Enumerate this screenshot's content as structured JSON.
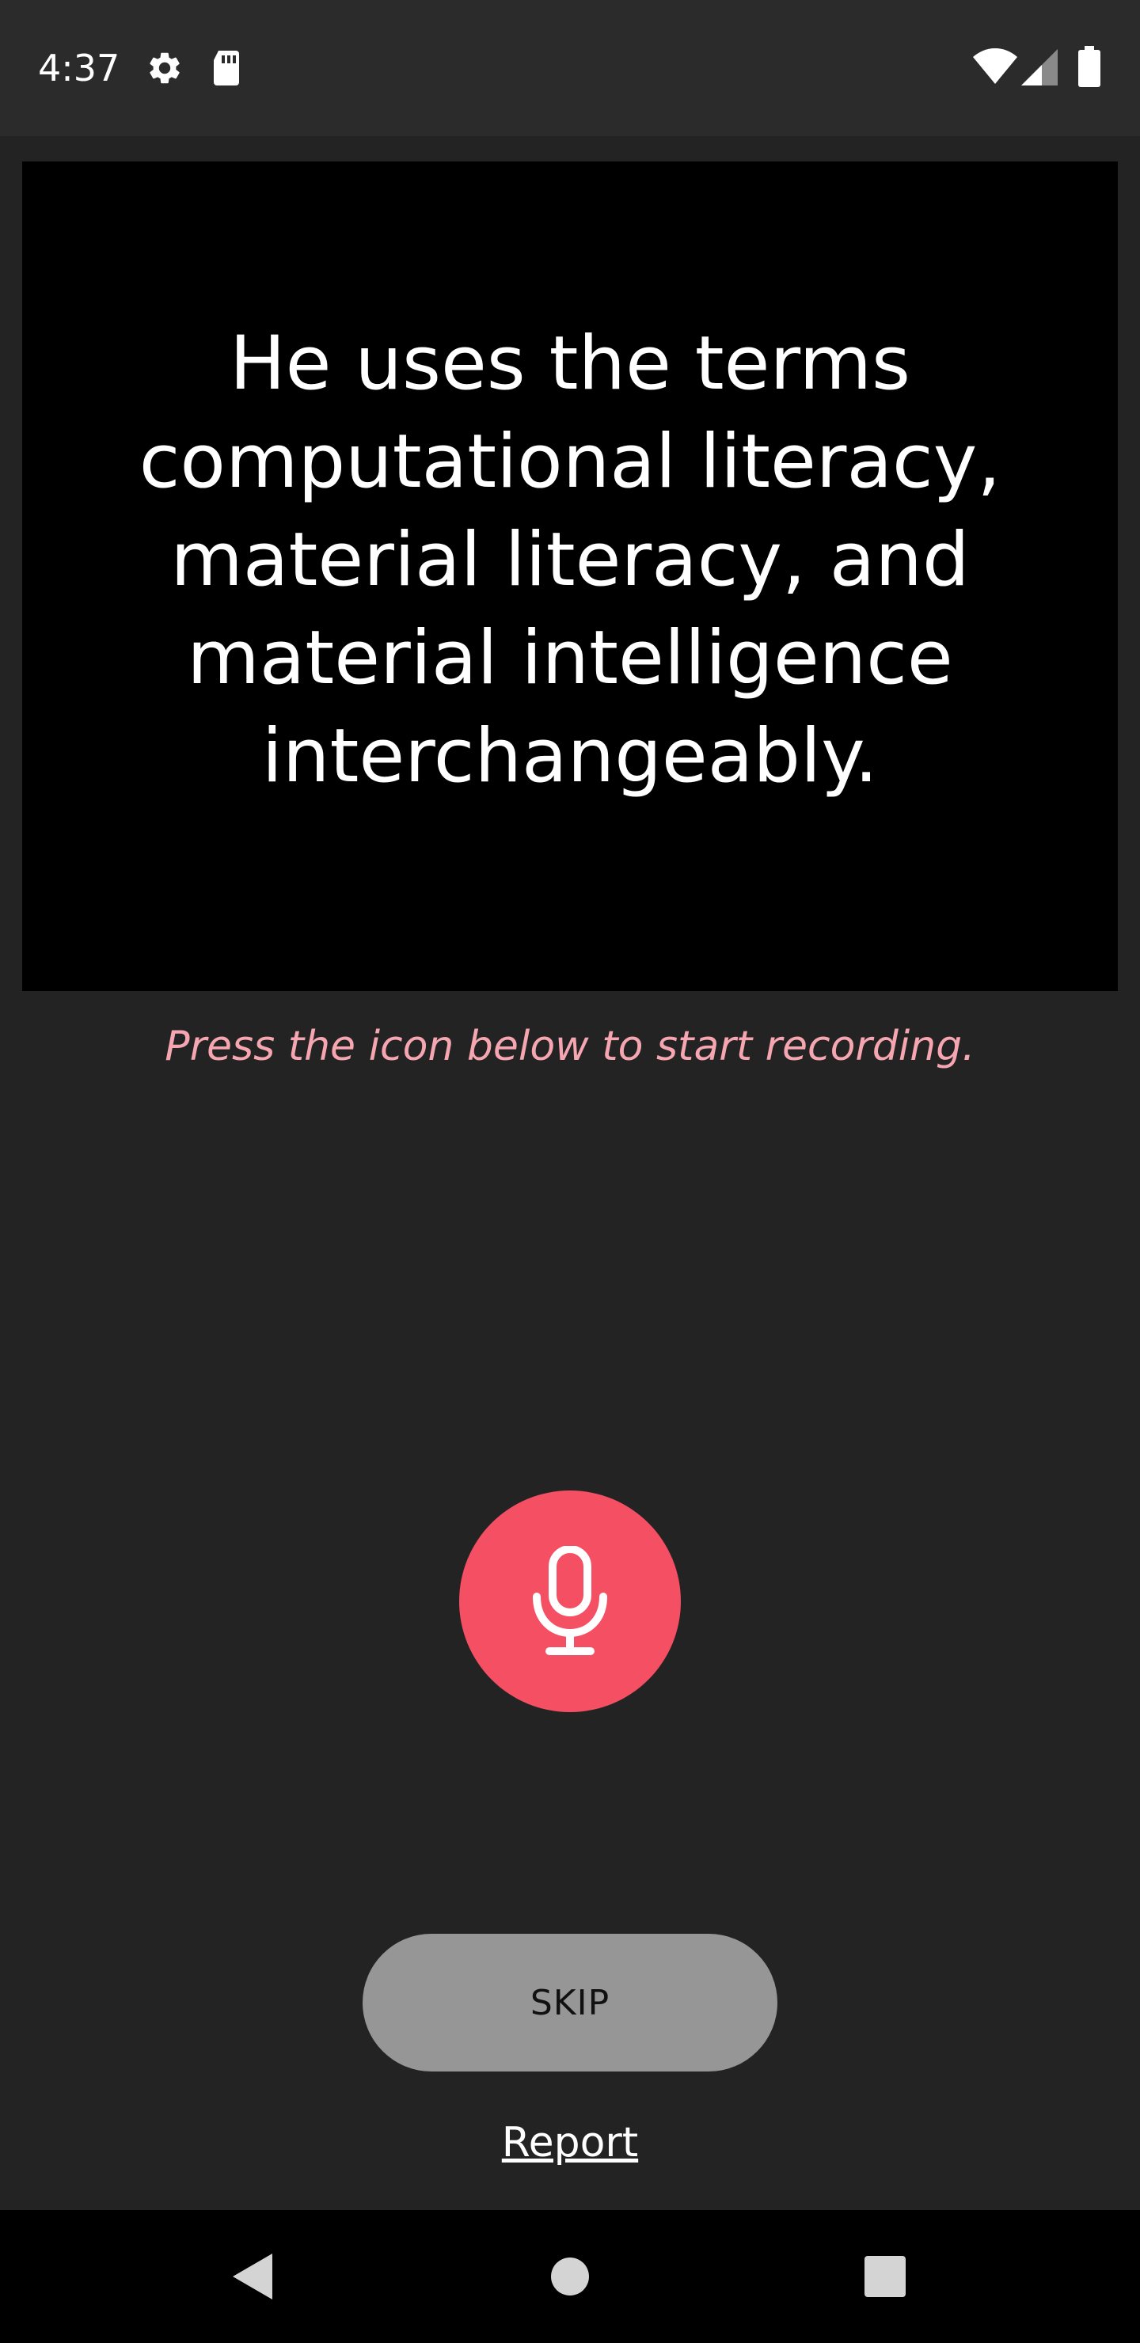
{
  "status_bar": {
    "time": "4:37",
    "icons_left": [
      "settings-gear-icon",
      "sd-card-icon"
    ],
    "icons_right": [
      "wifi-icon",
      "cell-signal-icon",
      "battery-icon"
    ]
  },
  "prompt": {
    "text": "He uses the terms computational literacy, material literacy, and material intelligence interchangeably."
  },
  "hint": {
    "text": "Press the icon below to start recording."
  },
  "record": {
    "icon": "microphone-icon",
    "color": "#f54f63"
  },
  "actions": {
    "skip_label": "SKIP",
    "report_label": "Report"
  },
  "nav": {
    "buttons": [
      "back",
      "home",
      "recents"
    ]
  },
  "colors": {
    "background": "#232323",
    "card": "#000000",
    "hint": "#f5a6b0",
    "accent": "#f54f63",
    "skip_button": "#969696"
  }
}
